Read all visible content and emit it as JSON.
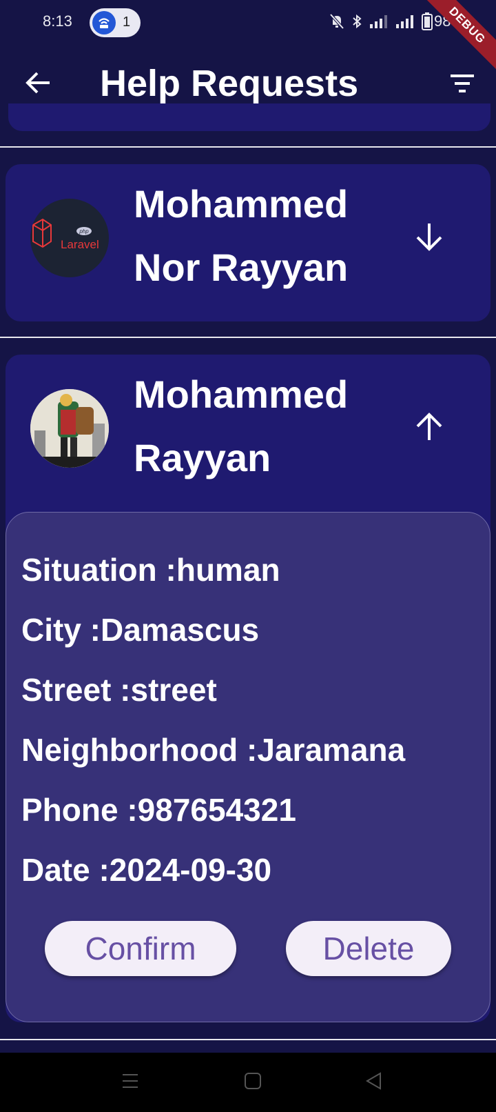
{
  "status_bar": {
    "time": "8:13",
    "hotspot_count": "1",
    "battery": "98%",
    "debug_label": "DEBUG"
  },
  "app_bar": {
    "title": "Help Requests"
  },
  "requests": [
    {
      "name_line1": "Mohammed",
      "name_line2": "Nor Rayyan",
      "avatar_label": "Laravel",
      "avatar_badge": "php",
      "expanded": false
    },
    {
      "name_line1": "Mohammed",
      "name_line2": "Rayyan",
      "expanded": true,
      "details": [
        "Situation :human",
        "City :Damascus",
        "Street :street",
        "Neighborhood :Jaramana",
        "Phone :987654321",
        "Date :2024-09-30"
      ],
      "confirm_label": "Confirm",
      "delete_label": "Delete"
    }
  ],
  "colors": {
    "background": "#151446",
    "card": "#1f1a70",
    "details_panel": "#373178",
    "button_bg": "#f3eef8",
    "button_text": "#6750a4",
    "laravel_red": "#e8383a"
  }
}
